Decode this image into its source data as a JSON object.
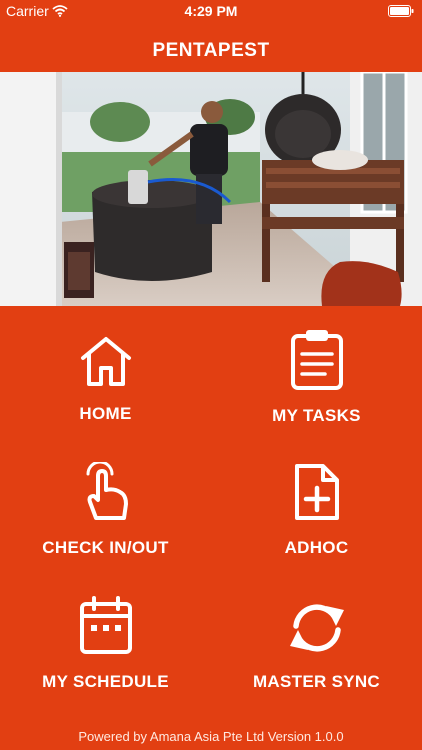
{
  "status_bar": {
    "carrier": "Carrier",
    "time": "4:29 PM"
  },
  "header": {
    "title": "PENTAPEST"
  },
  "menu": {
    "items": [
      {
        "label": "HOME",
        "icon": "home-icon"
      },
      {
        "label": "MY TASKS",
        "icon": "clipboard-icon"
      },
      {
        "label": "CHECK IN/OUT",
        "icon": "tap-hand-icon"
      },
      {
        "label": "ADHOC",
        "icon": "add-document-icon"
      },
      {
        "label": "MY SCHEDULE",
        "icon": "calendar-icon"
      },
      {
        "label": "MASTER SYNC",
        "icon": "sync-icon"
      }
    ]
  },
  "footer": {
    "text": "Powered by Amana Asia Pte Ltd Version 1.0.0"
  },
  "colors": {
    "background": "#e23f12",
    "text": "#ffffff"
  }
}
